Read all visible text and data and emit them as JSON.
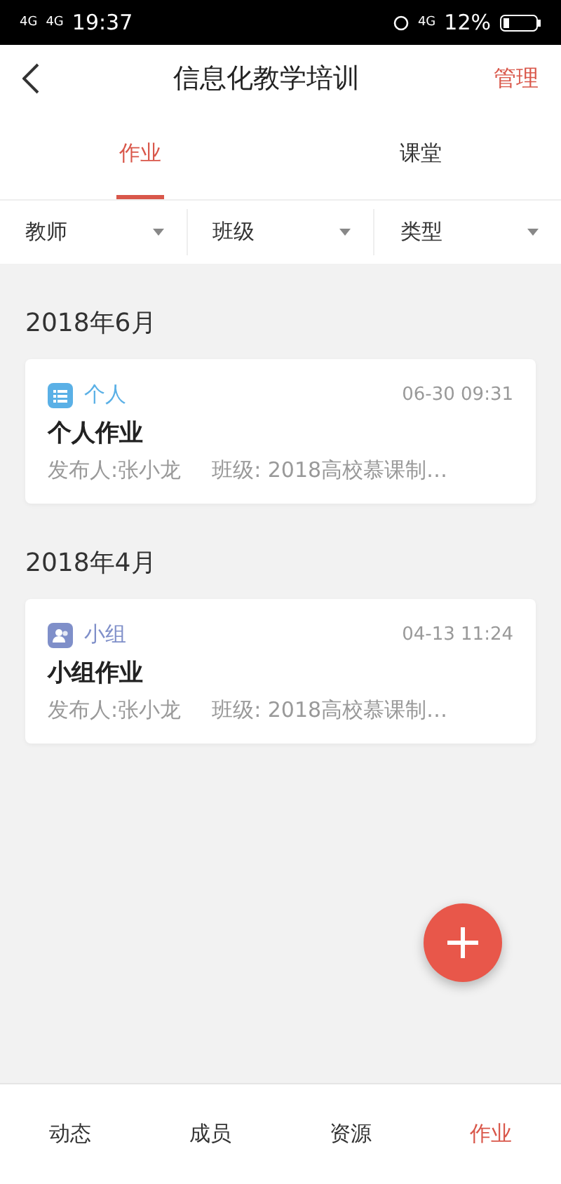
{
  "status_bar": {
    "carriers": [
      "4G",
      "4G"
    ],
    "time": "19:37",
    "network": "4G",
    "battery": "12%"
  },
  "nav": {
    "title": "信息化教学培训",
    "action": "管理"
  },
  "tabs": [
    {
      "label": "作业",
      "selected": true
    },
    {
      "label": "课堂",
      "selected": false
    }
  ],
  "filters": [
    "教师",
    "班级",
    "类型"
  ],
  "sections": [
    {
      "month": "2018年6月",
      "items": [
        {
          "kind": "personal",
          "type": "个人",
          "time": "06-30 09:31",
          "title": "个人作业",
          "publisher": "发布人:张小龙",
          "class": "班级: 2018高校慕课制…"
        }
      ]
    },
    {
      "month": "2018年4月",
      "items": [
        {
          "kind": "group",
          "type": "小组",
          "time": "04-13 11:24",
          "title": "小组作业",
          "publisher": "发布人:张小龙",
          "class": "班级: 2018高校慕课制…"
        }
      ]
    }
  ],
  "bottom_tabs": [
    {
      "label": "动态",
      "selected": false
    },
    {
      "label": "成员",
      "selected": false
    },
    {
      "label": "资源",
      "selected": false
    },
    {
      "label": "作业",
      "selected": true
    }
  ]
}
